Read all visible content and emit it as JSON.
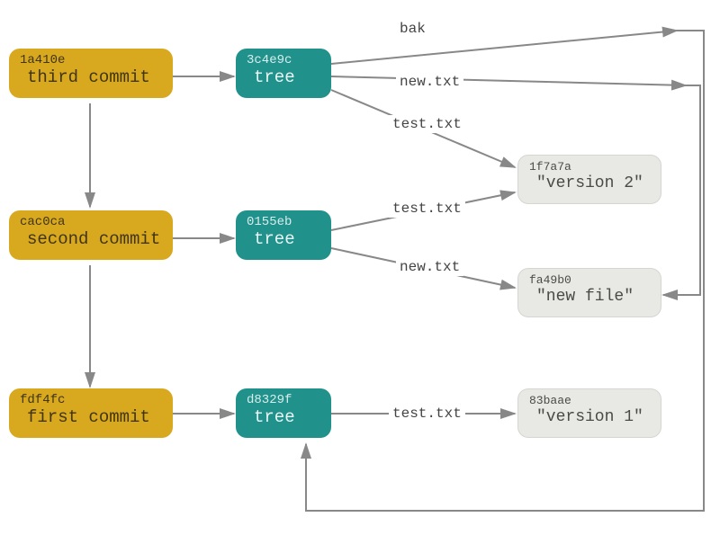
{
  "commits": [
    {
      "hash": "1a410e",
      "label": "third commit"
    },
    {
      "hash": "cac0ca",
      "label": "second commit"
    },
    {
      "hash": "fdf4fc",
      "label": "first commit"
    }
  ],
  "trees": [
    {
      "hash": "3c4e9c",
      "label": "tree"
    },
    {
      "hash": "0155eb",
      "label": "tree"
    },
    {
      "hash": "d8329f",
      "label": "tree"
    }
  ],
  "blobs": [
    {
      "hash": "1f7a7a",
      "label": "\"version 2\""
    },
    {
      "hash": "fa49b0",
      "label": "\"new file\""
    },
    {
      "hash": "83baae",
      "label": "\"version 1\""
    }
  ],
  "edgeLabels": {
    "bak": "bak",
    "new_txt": "new.txt",
    "test_txt": "test.txt"
  }
}
